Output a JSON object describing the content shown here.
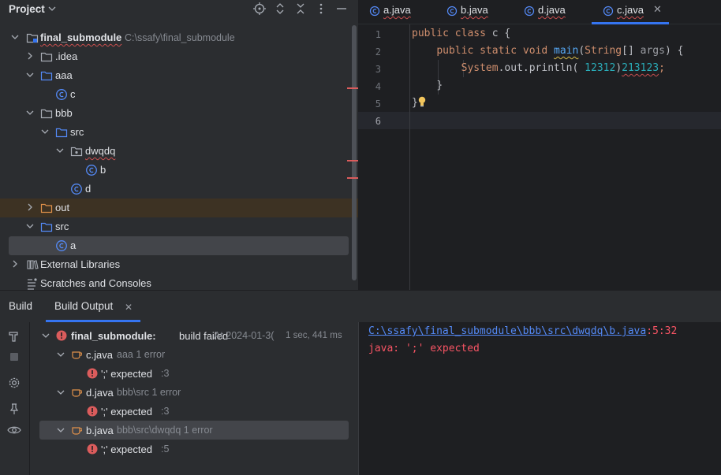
{
  "project": {
    "title": "Project",
    "tree": [
      {
        "label": "final_submodule",
        "hint": "C:\\ssafy\\final_submodule"
      },
      {
        "label": ".idea"
      },
      {
        "label": "aaa"
      },
      {
        "label": "c"
      },
      {
        "label": "bbb"
      },
      {
        "label": "src"
      },
      {
        "label": "dwqdq"
      },
      {
        "label": "b"
      },
      {
        "label": "d"
      },
      {
        "label": "out"
      },
      {
        "label": "src"
      },
      {
        "label": "a"
      },
      {
        "label": "External Libraries"
      },
      {
        "label": "Scratches and Consoles"
      }
    ]
  },
  "editor": {
    "tabs": [
      {
        "label": "a.java"
      },
      {
        "label": "b.java"
      },
      {
        "label": "d.java"
      },
      {
        "label": "c.java",
        "active": true
      }
    ],
    "line_numbers": [
      "1",
      "2",
      "3",
      "4",
      "5",
      "6"
    ],
    "code": {
      "l1_kw": "public class ",
      "l1_name": "c",
      "l1_brace": " {",
      "l2_kw": "public static void ",
      "l2_fn": "main",
      "l2_paren": "(",
      "l2_type": "String",
      "l2_arr": "[] ",
      "l2_param": "args",
      "l2_end": ") {",
      "l3_cls": "System",
      "l3_mid": ".out.println(",
      "l3_num1": " 12312",
      "l3_close": ")",
      "l3_num2": "213123",
      "l3_semi": ";",
      "l4": "}",
      "l5": "}"
    }
  },
  "build": {
    "tab_build": "Build",
    "tab_output": "Build Output",
    "root": {
      "label": "final_submodule:",
      "status": "build failed",
      "time": "At 2024-01-3(",
      "duration": "1 sec, 441 ms"
    },
    "files": [
      {
        "name": "c.java",
        "hint": "aaa 1 error",
        "error": "';' expected",
        "line": ":3"
      },
      {
        "name": "d.java",
        "hint": "bbb\\src 1 error",
        "error": "';' expected",
        "line": ":3"
      },
      {
        "name": "b.java",
        "hint": "bbb\\src\\dwqdq 1 error",
        "error": "';' expected",
        "line": ":5"
      }
    ],
    "output": {
      "path": "C:\\ssafy\\final_submodule\\bbb\\src\\dwqdq\\b.java",
      "pos": ":5:32",
      "message": "java: ';' expected"
    }
  },
  "colors": {
    "accent": "#3574f0",
    "error": "#db5c5c",
    "keyword": "#cf8e6d",
    "function": "#56a8f5",
    "number": "#2aacb8"
  }
}
